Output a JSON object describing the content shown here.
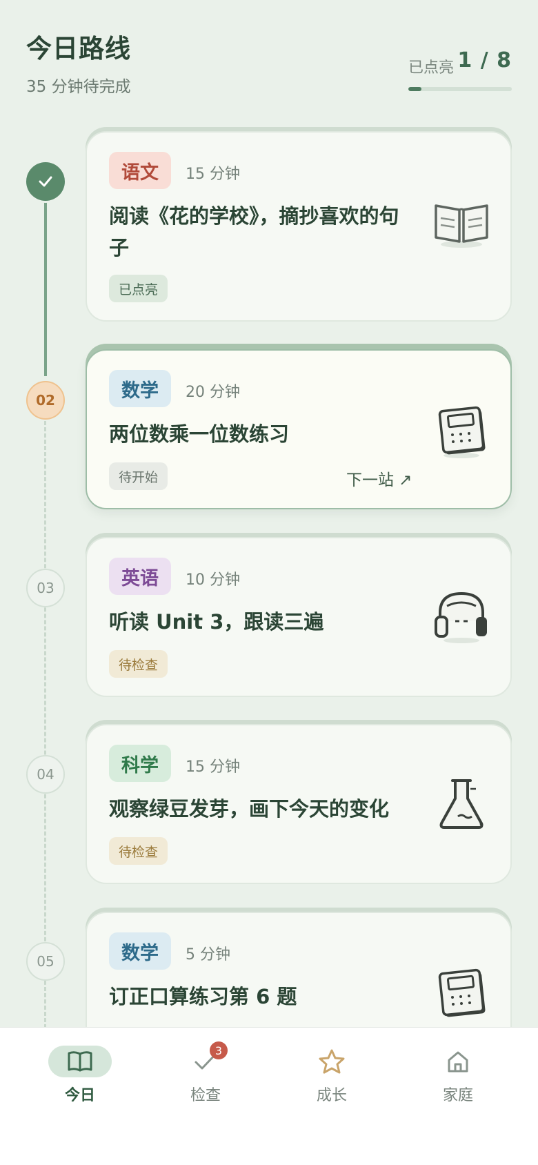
{
  "header": {
    "title": "今日路线",
    "subtitle": "35 分钟待完成",
    "progress_label": "已点亮",
    "progress_value": "1 / 8",
    "progress_fraction": 0.125
  },
  "timeline": {
    "nodes": [
      {
        "label": "",
        "state": "done",
        "icon": "check-icon"
      },
      {
        "label": "02",
        "state": "current"
      },
      {
        "label": "03",
        "state": "pending"
      },
      {
        "label": "04",
        "state": "pending"
      },
      {
        "label": "05",
        "state": "pending"
      }
    ]
  },
  "tasks": [
    {
      "subject": "语文",
      "duration": "15 分钟",
      "title": "阅读《花的学校》，摘抄喜欢的句子",
      "status": "已点亮",
      "icon": "book-icon"
    },
    {
      "subject": "数学",
      "duration": "20 分钟",
      "title": "两位数乘一位数练习",
      "status": "待开始",
      "next_label": "下一站 ↗",
      "icon": "calculator-icon"
    },
    {
      "subject": "英语",
      "duration": "10 分钟",
      "title": "听读 Unit 3，跟读三遍",
      "status": "待检查",
      "icon": "headphones-icon"
    },
    {
      "subject": "科学",
      "duration": "15 分钟",
      "title": "观察绿豆发芽，画下今天的变化",
      "status": "待检查",
      "icon": "flask-icon"
    },
    {
      "subject": "数学",
      "duration": "5 分钟",
      "title": "订正口算练习第 6 题",
      "icon": "calculator-icon"
    }
  ],
  "nav": {
    "items": [
      {
        "label": "今日",
        "icon": "book-open-icon",
        "active": true
      },
      {
        "label": "检查",
        "icon": "check-icon",
        "badge": "3"
      },
      {
        "label": "成长",
        "icon": "star-icon"
      },
      {
        "label": "家庭",
        "icon": "home-icon"
      }
    ]
  },
  "colors": {
    "background": "#eaf1ea",
    "accent": "#5a8a6b",
    "current_node": "#f6dcbf",
    "badge": "#c65a4a"
  }
}
